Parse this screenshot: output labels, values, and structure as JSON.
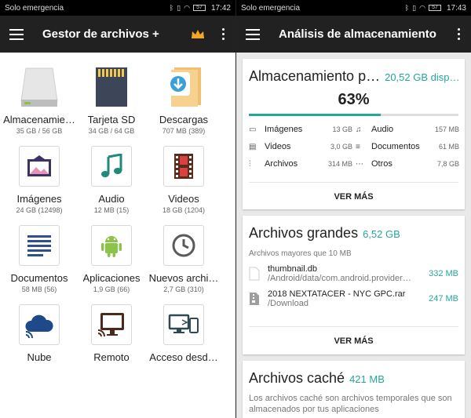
{
  "left": {
    "status": {
      "carrier": "Solo emergencia",
      "battery": "57",
      "time": "17:42"
    },
    "appbar": {
      "title": "Gestor de archivos +"
    },
    "items": [
      {
        "label": "Almacenamie…",
        "sub": "35 GB / 56 GB"
      },
      {
        "label": "Tarjeta SD",
        "sub": "34 GB / 64 GB"
      },
      {
        "label": "Descargas",
        "sub": "707 MB (389)"
      },
      {
        "label": "Imágenes",
        "sub": "24 GB (12498)"
      },
      {
        "label": "Audio",
        "sub": "12 MB (15)"
      },
      {
        "label": "Videos",
        "sub": "18 GB (1204)"
      },
      {
        "label": "Documentos",
        "sub": "58 MB (56)"
      },
      {
        "label": "Aplicaciones",
        "sub": "1,9 GB (66)"
      },
      {
        "label": "Nuevos archi…",
        "sub": "2,7 GB (310)"
      },
      {
        "label": "Nube",
        "sub": ""
      },
      {
        "label": "Remoto",
        "sub": ""
      },
      {
        "label": "Acceso desd…",
        "sub": ""
      }
    ]
  },
  "right": {
    "status": {
      "carrier": "Solo emergencia",
      "battery": "57",
      "time": "17:43"
    },
    "appbar": {
      "title": "Análisis de almacenamiento"
    },
    "storage": {
      "title": "Almacenamiento p…",
      "available": "20,52 GB disp…",
      "percent_label": "63%",
      "percent": 63,
      "categories": [
        {
          "name": "Imágenes",
          "value": "13 GB"
        },
        {
          "name": "Audio",
          "value": "157 MB"
        },
        {
          "name": "Videos",
          "value": "3,0 GB"
        },
        {
          "name": "Documentos",
          "value": "61 MB"
        },
        {
          "name": "Archivos",
          "value": "314 MB"
        },
        {
          "name": "Otros",
          "value": "7,8 GB"
        }
      ],
      "more": "VER MÁS"
    },
    "large": {
      "title": "Archivos grandes",
      "size": "6,52 GB",
      "desc": "Archivos mayores que 10 MB",
      "files": [
        {
          "name": "thumbnail.db",
          "path": "/Android/data/com.android.provider…",
          "size": "332 MB"
        },
        {
          "name": "2018 NEXTATACER - NYC GPC.rar",
          "path": "/Download",
          "size": "247 MB"
        }
      ],
      "more": "VER MÁS"
    },
    "cache": {
      "title": "Archivos caché",
      "size": "421 MB",
      "desc": "Los archivos caché son archivos temporales que son almacenados por tus aplicaciones"
    }
  },
  "colors": {
    "accent": "#26a69a",
    "appbar": "#212121",
    "crown": "#f5a623"
  }
}
